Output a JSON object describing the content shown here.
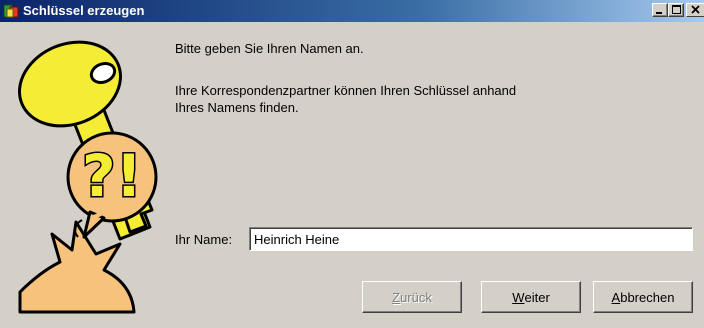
{
  "window": {
    "title": "Schlüssel erzeugen",
    "controls": {
      "minimize_icon": "minimize-icon",
      "maximize_icon": "maximize-icon",
      "close_icon": "close-icon"
    }
  },
  "illustration": {
    "icon": "key-question-icon",
    "glyphs": "?!"
  },
  "content": {
    "instruction": "Bitte geben Sie Ihren Namen an.",
    "description_line1": "Ihre Korrespondenzpartner können Ihren Schlüssel anhand",
    "description_line2": "Ihres Namens finden."
  },
  "form": {
    "name_label": "Ihr Name:",
    "name_value": "Heinrich Heine"
  },
  "buttons": {
    "back": {
      "mnemonic": "Z",
      "rest": "urück",
      "enabled": false
    },
    "next": {
      "mnemonic": "W",
      "rest": "eiter",
      "enabled": true
    },
    "cancel": {
      "mnemonic": "A",
      "rest": "bbrechen",
      "enabled": true
    }
  },
  "colors": {
    "titlebar_start": "#0a246a",
    "titlebar_end": "#a6caf0",
    "dialog_bg": "#d4d0c8",
    "key_yellow": "#f5ec36",
    "bubble_orange": "#f6c27c"
  }
}
